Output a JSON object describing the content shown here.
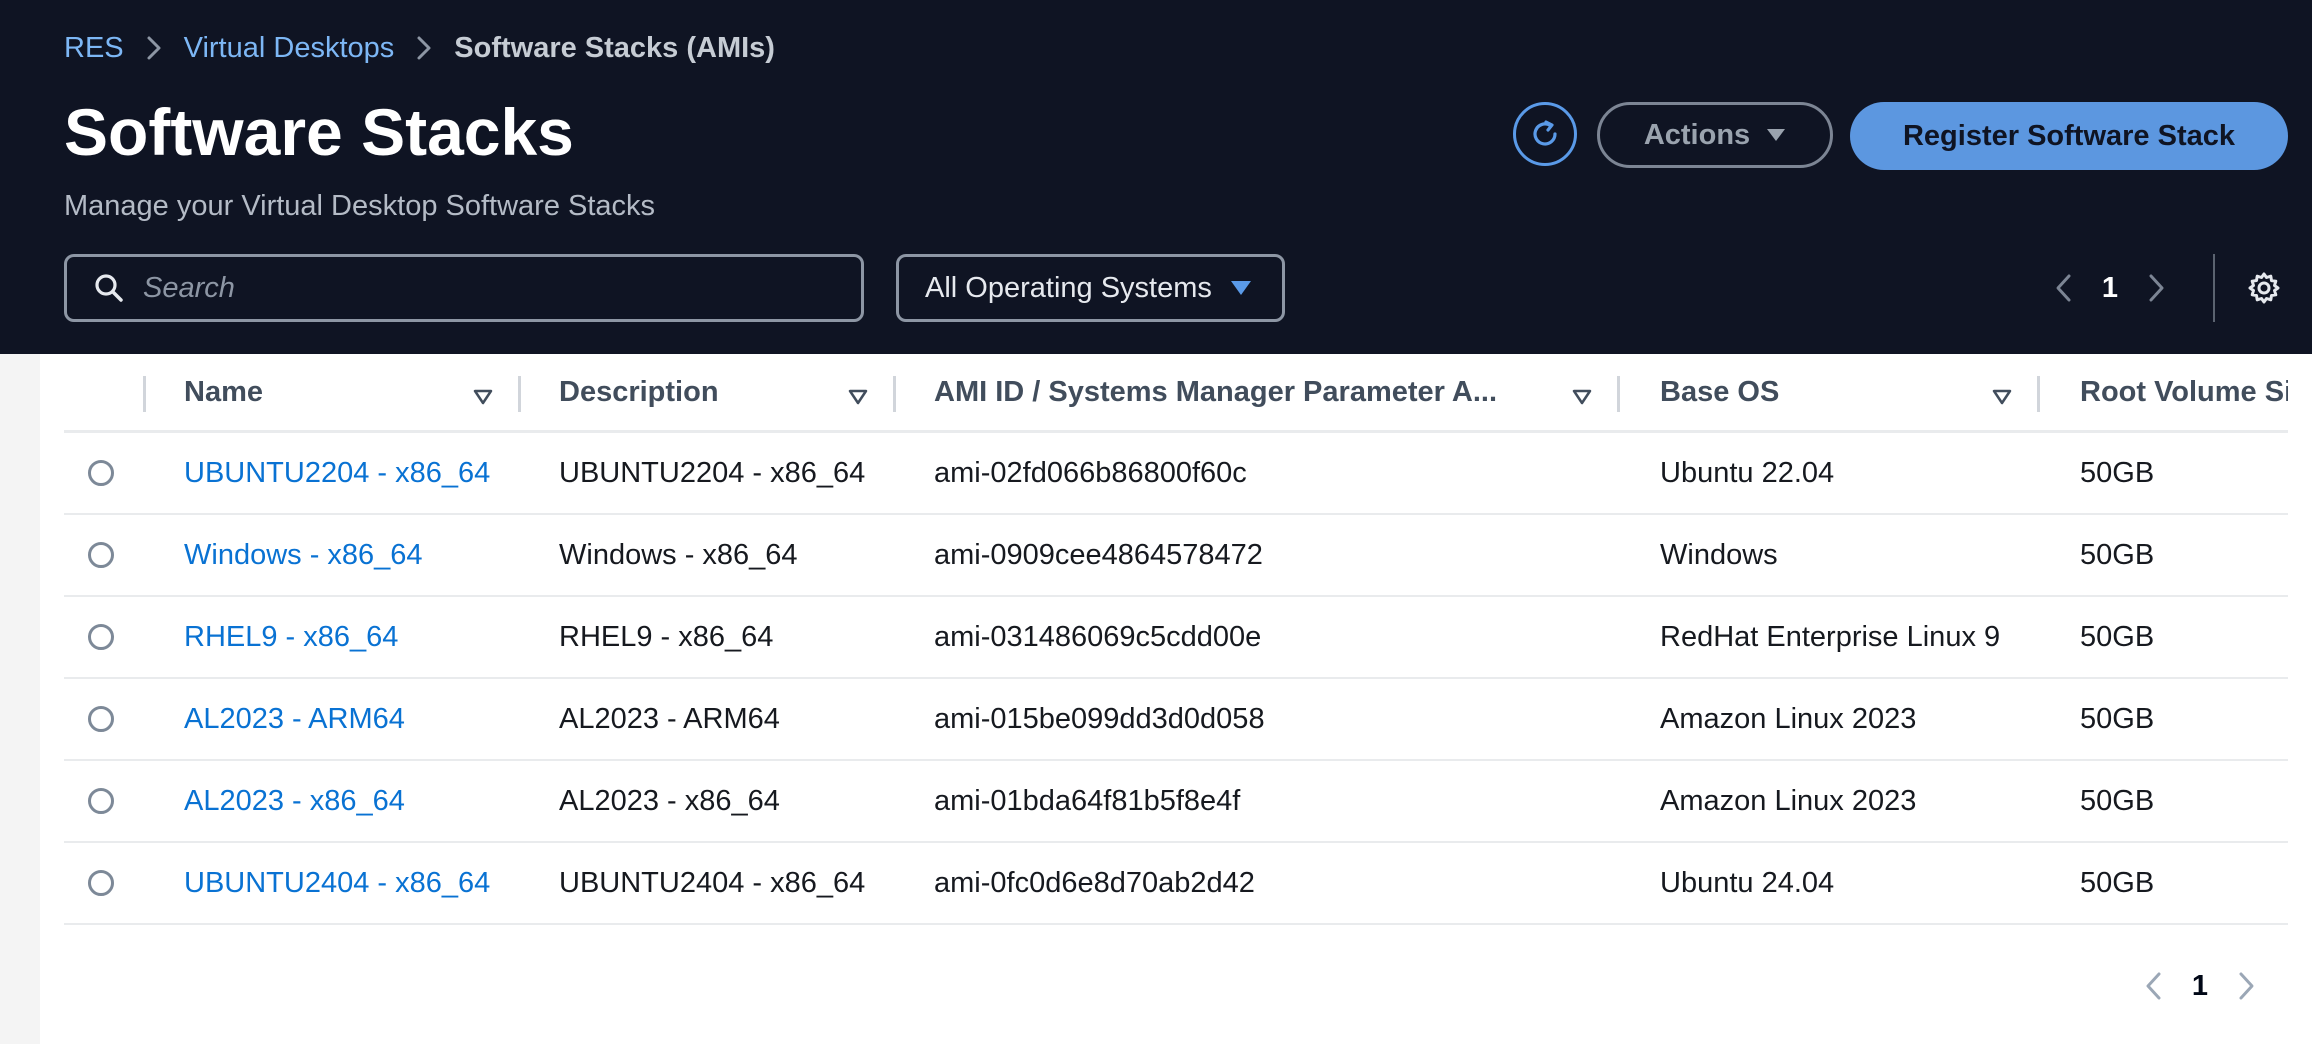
{
  "breadcrumb": {
    "items": [
      {
        "label": "RES"
      },
      {
        "label": "Virtual Desktops"
      },
      {
        "label": "Software Stacks (AMIs)"
      }
    ]
  },
  "header": {
    "title": "Software Stacks",
    "subtitle": "Manage your Virtual Desktop Software Stacks",
    "actions_label": "Actions",
    "register_label": "Register Software Stack"
  },
  "filters": {
    "search_placeholder": "Search",
    "search_value": "",
    "os_filter_selected": "All Operating Systems"
  },
  "pagination": {
    "current_page": "1"
  },
  "table": {
    "columns": [
      {
        "label": "Name"
      },
      {
        "label": "Description"
      },
      {
        "label": "AMI ID / Systems Manager Parameter A..."
      },
      {
        "label": "Base OS"
      },
      {
        "label": "Root Volume Size"
      }
    ],
    "rows": [
      {
        "name": "UBUNTU2204 - x86_64",
        "description": "UBUNTU2204 - x86_64",
        "ami_id": "ami-02fd066b86800f60c",
        "base_os": "Ubuntu 22.04",
        "root_volume": "50GB"
      },
      {
        "name": "Windows - x86_64",
        "description": "Windows - x86_64",
        "ami_id": "ami-0909cee4864578472",
        "base_os": "Windows",
        "root_volume": "50GB"
      },
      {
        "name": "RHEL9 - x86_64",
        "description": "RHEL9 - x86_64",
        "ami_id": "ami-031486069c5cdd00e",
        "base_os": "RedHat Enterprise Linux 9",
        "root_volume": "50GB"
      },
      {
        "name": "AL2023 - ARM64",
        "description": "AL2023 - ARM64",
        "ami_id": "ami-015be099dd3d0d058",
        "base_os": "Amazon Linux 2023",
        "root_volume": "50GB"
      },
      {
        "name": "AL2023 - x86_64",
        "description": "AL2023 - x86_64",
        "ami_id": "ami-01bda64f81b5f8e4f",
        "base_os": "Amazon Linux 2023",
        "root_volume": "50GB"
      },
      {
        "name": "UBUNTU2404 - x86_64",
        "description": "UBUNTU2404 - x86_64",
        "ami_id": "ami-0fc0d6e8d70ab2d42",
        "base_os": "Ubuntu 24.04",
        "root_volume": "50GB"
      }
    ]
  },
  "icons": {
    "breadcrumb_separator": "chevron-right-icon",
    "refresh": "refresh-icon",
    "dropdown": "caret-down-icon",
    "search": "search-icon",
    "prev": "chevron-left-icon",
    "next": "chevron-right-icon",
    "settings": "gear-icon",
    "sort": "sort-caret-icon"
  },
  "colors": {
    "header_bg": "#0f1423",
    "accent": "#5c97e0",
    "link": "#0972d3",
    "breadcrumb_link": "#7db7f5"
  }
}
